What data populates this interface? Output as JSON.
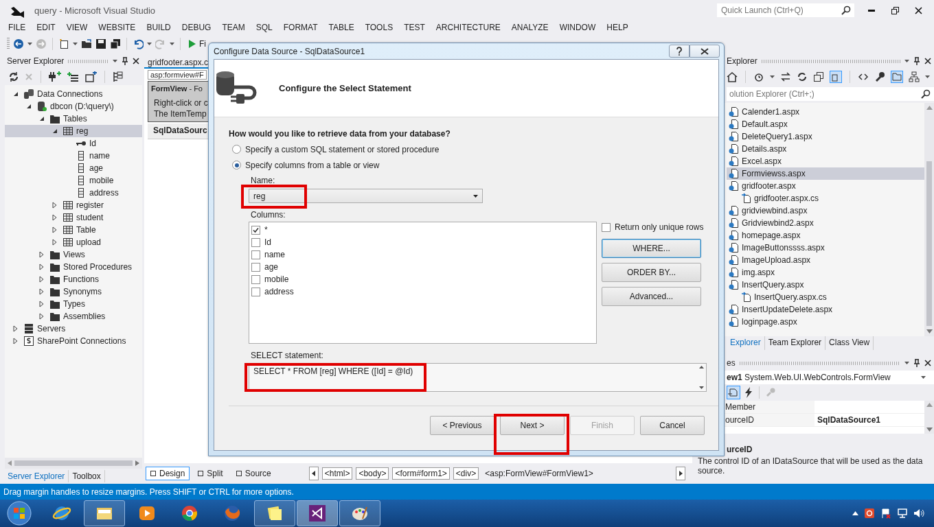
{
  "window": {
    "title": "query - Microsoft Visual Studio",
    "quick_launch": {
      "placeholder": "Quick Launch (Ctrl+Q)"
    }
  },
  "menu": [
    "FILE",
    "EDIT",
    "VIEW",
    "WEBSITE",
    "BUILD",
    "DEBUG",
    "TEAM",
    "SQL",
    "FORMAT",
    "TABLE",
    "TOOLS",
    "TEST",
    "ARCHITECTURE",
    "ANALYZE",
    "WINDOW",
    "HELP"
  ],
  "toolbar": {
    "run_label": "Fi"
  },
  "server_explorer": {
    "title": "Server Explorer",
    "tree": [
      {
        "label": "Data Connections",
        "kind": "connections",
        "expanded": true,
        "selected": false,
        "children": [
          {
            "label": "dbcon (D:\\query\\)",
            "kind": "database",
            "expanded": true,
            "selected": false,
            "children": [
              {
                "label": "Tables",
                "kind": "folder",
                "expanded": true,
                "selected": false,
                "children": [
                  {
                    "label": "reg",
                    "kind": "table",
                    "expanded": true,
                    "selected": true,
                    "children": [
                      {
                        "label": "Id",
                        "kind": "key",
                        "selected": false
                      },
                      {
                        "label": "name",
                        "kind": "column",
                        "selected": false
                      },
                      {
                        "label": "age",
                        "kind": "column",
                        "selected": false
                      },
                      {
                        "label": "mobile",
                        "kind": "column",
                        "selected": false
                      },
                      {
                        "label": "address",
                        "kind": "column",
                        "selected": false
                      }
                    ]
                  },
                  {
                    "label": "register",
                    "kind": "table",
                    "expanded": false,
                    "selected": false
                  },
                  {
                    "label": "student",
                    "kind": "table",
                    "expanded": false,
                    "selected": false
                  },
                  {
                    "label": "Table",
                    "kind": "table",
                    "expanded": false,
                    "selected": false
                  },
                  {
                    "label": "upload",
                    "kind": "table",
                    "expanded": false,
                    "selected": false
                  }
                ]
              },
              {
                "label": "Views",
                "kind": "folder",
                "expanded": false,
                "selected": false
              },
              {
                "label": "Stored Procedures",
                "kind": "folder",
                "expanded": false,
                "selected": false
              },
              {
                "label": "Functions",
                "kind": "folder",
                "expanded": false,
                "selected": false
              },
              {
                "label": "Synonyms",
                "kind": "folder",
                "expanded": false,
                "selected": false
              },
              {
                "label": "Types",
                "kind": "folder",
                "expanded": false,
                "selected": false
              },
              {
                "label": "Assemblies",
                "kind": "folder",
                "expanded": false,
                "selected": false
              }
            ]
          }
        ]
      },
      {
        "label": "Servers",
        "kind": "server",
        "expanded": false,
        "selected": false
      },
      {
        "label": "SharePoint Connections",
        "kind": "sharepoint",
        "expanded": false,
        "selected": false
      }
    ],
    "tabs": [
      {
        "label": "Server Explorer",
        "selected": true
      },
      {
        "label": "Toolbox",
        "selected": false
      }
    ]
  },
  "document": {
    "tab": "gridfooter.aspx.c",
    "tag": "asp:formview#F",
    "formview_title": "**FormView** - Fo",
    "formview_text": [
      "Right-click or c",
      "The ItemTemp"
    ],
    "datasource": "SqlDataSourc",
    "views": [
      {
        "label": "Design",
        "selected": true
      },
      {
        "label": "Split",
        "selected": false
      },
      {
        "label": "Source",
        "selected": false
      }
    ],
    "path": [
      "<html>",
      "<body>",
      "<form#form1>",
      "<div>",
      "<asp:FormView#FormView1>"
    ]
  },
  "solution_explorer": {
    "title": "Explorer",
    "search": {
      "placeholder": "olution Explorer (Ctrl+;)"
    },
    "files": [
      {
        "label": "Calender1.aspx",
        "kind": "page",
        "selected": false
      },
      {
        "label": "Default.aspx",
        "kind": "page",
        "selected": false
      },
      {
        "label": "DeleteQuery1.aspx",
        "kind": "page",
        "selected": false
      },
      {
        "label": "Details.aspx",
        "kind": "page",
        "selected": false
      },
      {
        "label": "Excel.aspx",
        "kind": "page",
        "selected": false
      },
      {
        "label": "Formviewss.aspx",
        "kind": "page",
        "selected": true
      },
      {
        "label": "gridfooter.aspx",
        "kind": "page",
        "selected": false,
        "children": [
          {
            "label": "gridfooter.aspx.cs",
            "kind": "code",
            "selected": false
          }
        ]
      },
      {
        "label": "gridviewbind.aspx",
        "kind": "page",
        "selected": false
      },
      {
        "label": "Gridviewbind2.aspx",
        "kind": "page",
        "selected": false
      },
      {
        "label": "homepage.aspx",
        "kind": "page",
        "selected": false
      },
      {
        "label": "ImageButtonssss.aspx",
        "kind": "page",
        "selected": false
      },
      {
        "label": "ImageUpload.aspx",
        "kind": "page",
        "selected": false
      },
      {
        "label": "img.aspx",
        "kind": "page",
        "selected": false
      },
      {
        "label": "InsertQuery.aspx",
        "kind": "page",
        "selected": false,
        "children": [
          {
            "label": "InsertQuery.aspx.cs",
            "kind": "code",
            "selected": false
          }
        ]
      },
      {
        "label": "InsertUpdateDelete.aspx",
        "kind": "page",
        "selected": false
      },
      {
        "label": "loginpage.aspx",
        "kind": "page",
        "selected": false
      }
    ],
    "tabs": [
      {
        "label": "Explorer",
        "selected": true
      },
      {
        "label": "Team Explorer",
        "selected": false
      },
      {
        "label": "Class View",
        "selected": false
      }
    ]
  },
  "properties": {
    "title": "es",
    "object": "**ew1** System.Web.UI.WebControls.FormView",
    "rows": [
      {
        "name": "Member"
      },
      {
        "name": "ourceID",
        "value": "SqlDataSource1"
      }
    ],
    "description": {
      "title": "urceID",
      "text": "The control ID of an IDataSource that will be used as the data source."
    }
  },
  "dialog": {
    "title": "Configure Data Source - SqlDataSource1",
    "heading": "Configure the Select Statement",
    "question": "How would you like to retrieve data from your database?",
    "options": [
      {
        "label": "Specify a custom SQL statement or stored procedure",
        "selected": false
      },
      {
        "label": "Specify columns from a table or view",
        "selected": true
      }
    ],
    "name_label": "Name:",
    "name_value": "reg",
    "columns_label": "Columns:",
    "columns": [
      {
        "label": "*",
        "checked": true
      },
      {
        "label": "Id",
        "checked": false
      },
      {
        "label": "name",
        "checked": false
      },
      {
        "label": "age",
        "checked": false
      },
      {
        "label": "mobile",
        "checked": false
      },
      {
        "label": "address",
        "checked": false
      }
    ],
    "unique_rows": {
      "label": "Return only unique rows",
      "checked": false
    },
    "side_buttons": [
      {
        "label": "WHERE...",
        "focused": true
      },
      {
        "label": "ORDER BY...",
        "focused": false
      },
      {
        "label": "Advanced...",
        "focused": false
      }
    ],
    "select_label": "SELECT statement:",
    "select_statement": "SELECT * FROM [reg] WHERE ([Id] = @Id)",
    "buttons": [
      {
        "label": "< Previous",
        "disabled": false
      },
      {
        "label": "Next >",
        "disabled": false
      },
      {
        "label": "Finish",
        "disabled": true
      },
      {
        "label": "Cancel",
        "disabled": false
      }
    ]
  },
  "status_bar": "Drag margin handles to resize margins. Press SHIFT or CTRL for more options.",
  "taskbar": {
    "apps": [
      {
        "kind": "globe",
        "open": false,
        "selected": false
      },
      {
        "kind": "folders",
        "open": true,
        "selected": false
      },
      {
        "kind": "player",
        "open": false,
        "selected": false
      },
      {
        "kind": "chrome",
        "open": false,
        "selected": false
      },
      {
        "kind": "fox",
        "open": false,
        "selected": false
      },
      {
        "kind": "notes",
        "open": true,
        "selected": false
      },
      {
        "kind": "studio",
        "open": true,
        "selected": true
      },
      {
        "kind": "palette",
        "open": true,
        "selected": false
      }
    ]
  }
}
